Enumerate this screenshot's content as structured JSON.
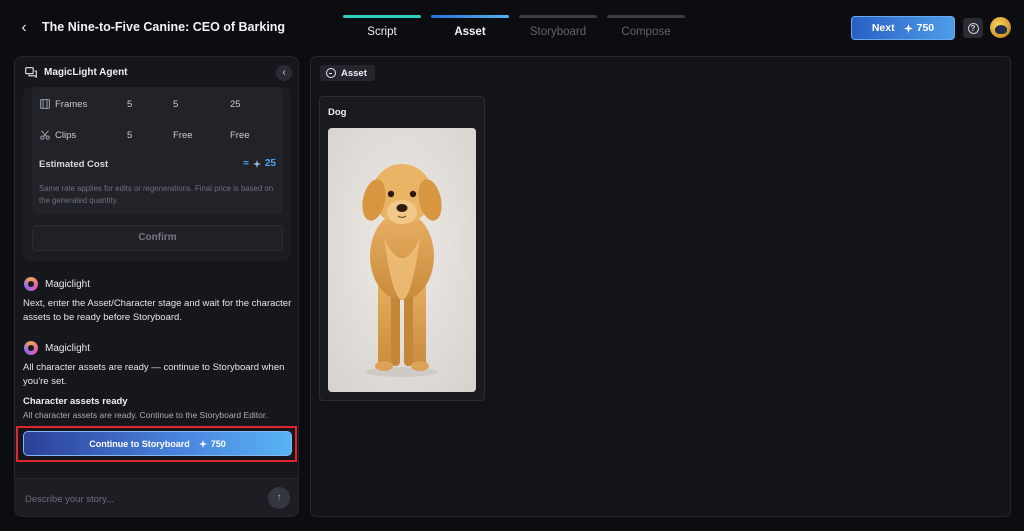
{
  "header": {
    "project_title": "The Nine-to-Five Canine: CEO of Barking",
    "steps": [
      {
        "label": "Script",
        "state": "done"
      },
      {
        "label": "Asset",
        "state": "active"
      },
      {
        "label": "Storyboard",
        "state": "pending"
      },
      {
        "label": "Compose",
        "state": "pending"
      }
    ],
    "next_label": "Next",
    "next_cost": "750",
    "accent_color": "#2fd0c2"
  },
  "agent": {
    "title": "MagicLight Agent",
    "cost_rows": [
      {
        "icon": "film-frame-icon",
        "name": "Frames",
        "c1": "5",
        "c2": "5",
        "c3": "25"
      },
      {
        "icon": "scissors-icon",
        "name": "Clips",
        "c1": "5",
        "c2": "Free",
        "c3": "Free"
      }
    ],
    "estimated_label": "Estimated Cost",
    "estimated_prefix": "≈",
    "estimated_value": "25",
    "note": "Same rate applies for edits or regenerations. Final price is based on the generated quantity.",
    "confirm_label": "Confirm",
    "messages": [
      {
        "sender": "Magiclight",
        "text": "Next, enter the Asset/Character stage and wait for the character assets to be ready before Storyboard."
      },
      {
        "sender": "Magiclight",
        "text": "All character assets are ready — continue to Storyboard when you're set."
      }
    ],
    "ready_title": "Character assets ready",
    "ready_subtitle": "All character assets are ready. Continue to the Storyboard Editor.",
    "cta_label": "Continue to Storyboard",
    "cta_cost": "750",
    "input_placeholder": "Describe your story...",
    "input_value": ""
  },
  "assets": {
    "tab_label": "Asset",
    "items": [
      {
        "name": "Dog",
        "image": "golden retriever puppy standing on light grey background"
      }
    ]
  }
}
